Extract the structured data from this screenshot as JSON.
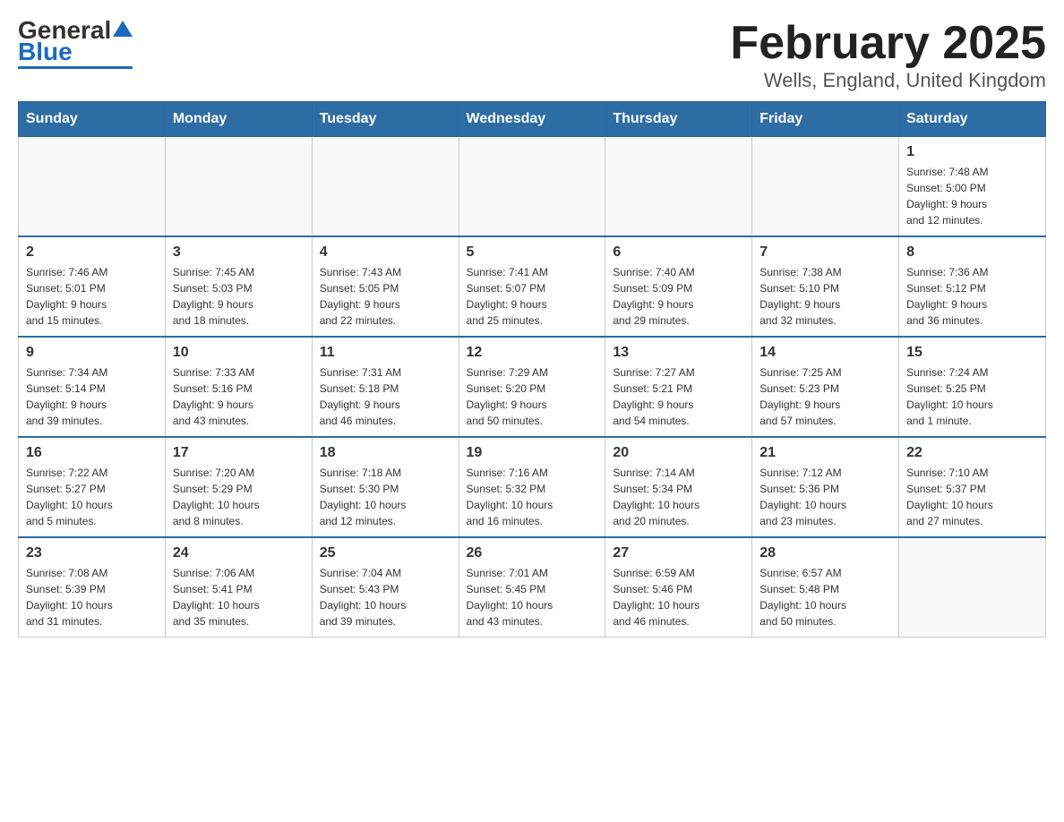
{
  "header": {
    "logo_general": "General",
    "logo_blue": "Blue",
    "title": "February 2025",
    "subtitle": "Wells, England, United Kingdom"
  },
  "weekdays": [
    "Sunday",
    "Monday",
    "Tuesday",
    "Wednesday",
    "Thursday",
    "Friday",
    "Saturday"
  ],
  "weeks": [
    [
      {
        "day": "",
        "info": ""
      },
      {
        "day": "",
        "info": ""
      },
      {
        "day": "",
        "info": ""
      },
      {
        "day": "",
        "info": ""
      },
      {
        "day": "",
        "info": ""
      },
      {
        "day": "",
        "info": ""
      },
      {
        "day": "1",
        "info": "Sunrise: 7:48 AM\nSunset: 5:00 PM\nDaylight: 9 hours\nand 12 minutes."
      }
    ],
    [
      {
        "day": "2",
        "info": "Sunrise: 7:46 AM\nSunset: 5:01 PM\nDaylight: 9 hours\nand 15 minutes."
      },
      {
        "day": "3",
        "info": "Sunrise: 7:45 AM\nSunset: 5:03 PM\nDaylight: 9 hours\nand 18 minutes."
      },
      {
        "day": "4",
        "info": "Sunrise: 7:43 AM\nSunset: 5:05 PM\nDaylight: 9 hours\nand 22 minutes."
      },
      {
        "day": "5",
        "info": "Sunrise: 7:41 AM\nSunset: 5:07 PM\nDaylight: 9 hours\nand 25 minutes."
      },
      {
        "day": "6",
        "info": "Sunrise: 7:40 AM\nSunset: 5:09 PM\nDaylight: 9 hours\nand 29 minutes."
      },
      {
        "day": "7",
        "info": "Sunrise: 7:38 AM\nSunset: 5:10 PM\nDaylight: 9 hours\nand 32 minutes."
      },
      {
        "day": "8",
        "info": "Sunrise: 7:36 AM\nSunset: 5:12 PM\nDaylight: 9 hours\nand 36 minutes."
      }
    ],
    [
      {
        "day": "9",
        "info": "Sunrise: 7:34 AM\nSunset: 5:14 PM\nDaylight: 9 hours\nand 39 minutes."
      },
      {
        "day": "10",
        "info": "Sunrise: 7:33 AM\nSunset: 5:16 PM\nDaylight: 9 hours\nand 43 minutes."
      },
      {
        "day": "11",
        "info": "Sunrise: 7:31 AM\nSunset: 5:18 PM\nDaylight: 9 hours\nand 46 minutes."
      },
      {
        "day": "12",
        "info": "Sunrise: 7:29 AM\nSunset: 5:20 PM\nDaylight: 9 hours\nand 50 minutes."
      },
      {
        "day": "13",
        "info": "Sunrise: 7:27 AM\nSunset: 5:21 PM\nDaylight: 9 hours\nand 54 minutes."
      },
      {
        "day": "14",
        "info": "Sunrise: 7:25 AM\nSunset: 5:23 PM\nDaylight: 9 hours\nand 57 minutes."
      },
      {
        "day": "15",
        "info": "Sunrise: 7:24 AM\nSunset: 5:25 PM\nDaylight: 10 hours\nand 1 minute."
      }
    ],
    [
      {
        "day": "16",
        "info": "Sunrise: 7:22 AM\nSunset: 5:27 PM\nDaylight: 10 hours\nand 5 minutes."
      },
      {
        "day": "17",
        "info": "Sunrise: 7:20 AM\nSunset: 5:29 PM\nDaylight: 10 hours\nand 8 minutes."
      },
      {
        "day": "18",
        "info": "Sunrise: 7:18 AM\nSunset: 5:30 PM\nDaylight: 10 hours\nand 12 minutes."
      },
      {
        "day": "19",
        "info": "Sunrise: 7:16 AM\nSunset: 5:32 PM\nDaylight: 10 hours\nand 16 minutes."
      },
      {
        "day": "20",
        "info": "Sunrise: 7:14 AM\nSunset: 5:34 PM\nDaylight: 10 hours\nand 20 minutes."
      },
      {
        "day": "21",
        "info": "Sunrise: 7:12 AM\nSunset: 5:36 PM\nDaylight: 10 hours\nand 23 minutes."
      },
      {
        "day": "22",
        "info": "Sunrise: 7:10 AM\nSunset: 5:37 PM\nDaylight: 10 hours\nand 27 minutes."
      }
    ],
    [
      {
        "day": "23",
        "info": "Sunrise: 7:08 AM\nSunset: 5:39 PM\nDaylight: 10 hours\nand 31 minutes."
      },
      {
        "day": "24",
        "info": "Sunrise: 7:06 AM\nSunset: 5:41 PM\nDaylight: 10 hours\nand 35 minutes."
      },
      {
        "day": "25",
        "info": "Sunrise: 7:04 AM\nSunset: 5:43 PM\nDaylight: 10 hours\nand 39 minutes."
      },
      {
        "day": "26",
        "info": "Sunrise: 7:01 AM\nSunset: 5:45 PM\nDaylight: 10 hours\nand 43 minutes."
      },
      {
        "day": "27",
        "info": "Sunrise: 6:59 AM\nSunset: 5:46 PM\nDaylight: 10 hours\nand 46 minutes."
      },
      {
        "day": "28",
        "info": "Sunrise: 6:57 AM\nSunset: 5:48 PM\nDaylight: 10 hours\nand 50 minutes."
      },
      {
        "day": "",
        "info": ""
      }
    ]
  ]
}
